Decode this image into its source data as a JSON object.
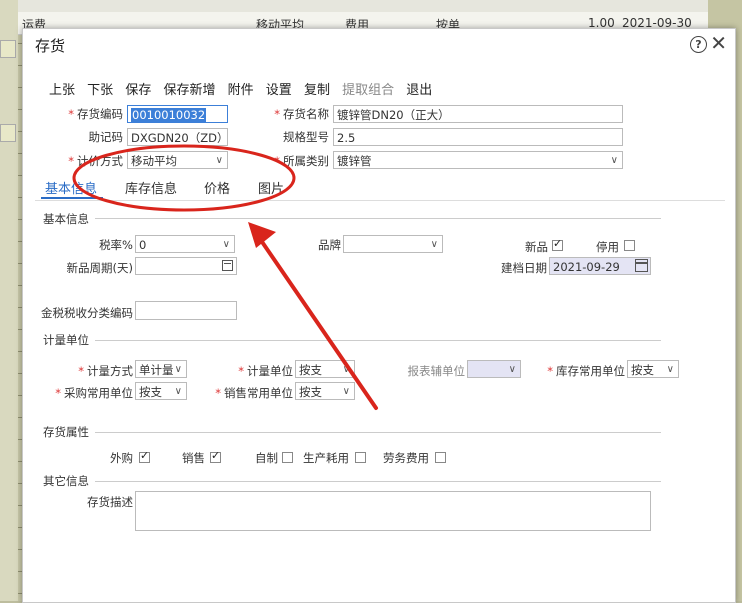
{
  "background": {
    "row": {
      "col1": "运费",
      "col2": "移动平均",
      "col3": "费用",
      "col4": "按单",
      "col5": "1.00",
      "col6": "2021-09-30"
    }
  },
  "dialog": {
    "title": "存货",
    "help_icon": "?",
    "close_icon": "✕"
  },
  "toolbar": {
    "items": [
      "上张",
      "下张",
      "保存",
      "保存新增",
      "附件",
      "设置",
      "复制",
      "提取组合",
      "退出"
    ]
  },
  "header_fields": {
    "code": {
      "label": "存货编码",
      "value": "0010010032"
    },
    "name": {
      "label": "存货名称",
      "value": "镀锌管DN20（正大）"
    },
    "mnemonic": {
      "label": "助记码",
      "value": "DXGDN20（ZD）"
    },
    "spec": {
      "label": "规格型号",
      "value": "2.5"
    },
    "pricing": {
      "label": "计价方式",
      "value": "移动平均"
    },
    "category": {
      "label": "所属类别",
      "value": "镀锌管"
    }
  },
  "tabs": [
    "基本信息",
    "库存信息",
    "价格",
    "图片"
  ],
  "basic": {
    "section": "基本信息",
    "tax_rate": {
      "label": "税率%",
      "value": "0"
    },
    "brand": {
      "label": "品牌",
      "value": ""
    },
    "new_product": {
      "label": "新品",
      "checked": true
    },
    "disabled": {
      "label": "停用",
      "checked": false
    },
    "new_period": {
      "label": "新品周期(天)",
      "value": ""
    },
    "created_date": {
      "label": "建档日期",
      "value": "2021-09-29"
    },
    "tax_code": {
      "label": "金税税收分类编码",
      "value": ""
    }
  },
  "unit": {
    "section": "计量单位",
    "measure_method": {
      "label": "计量方式",
      "value": "单计量"
    },
    "measure_unit": {
      "label": "计量单位",
      "value": "按支"
    },
    "report_unit": {
      "label": "报表辅单位",
      "value": ""
    },
    "stock_unit": {
      "label": "库存常用单位",
      "value": "按支"
    },
    "purchase_unit": {
      "label": "采购常用单位",
      "value": "按支"
    },
    "sales_unit": {
      "label": "销售常用单位",
      "value": "按支"
    }
  },
  "attributes": {
    "section": "存货属性",
    "items": [
      {
        "label": "外购",
        "checked": true
      },
      {
        "label": "销售",
        "checked": true
      },
      {
        "label": "自制",
        "checked": false
      },
      {
        "label": "生产耗用",
        "checked": false
      },
      {
        "label": "劳务费用",
        "checked": false
      }
    ]
  },
  "other": {
    "section": "其它信息",
    "description": {
      "label": "存货描述",
      "value": ""
    }
  },
  "annotation_color": "#d9251c"
}
